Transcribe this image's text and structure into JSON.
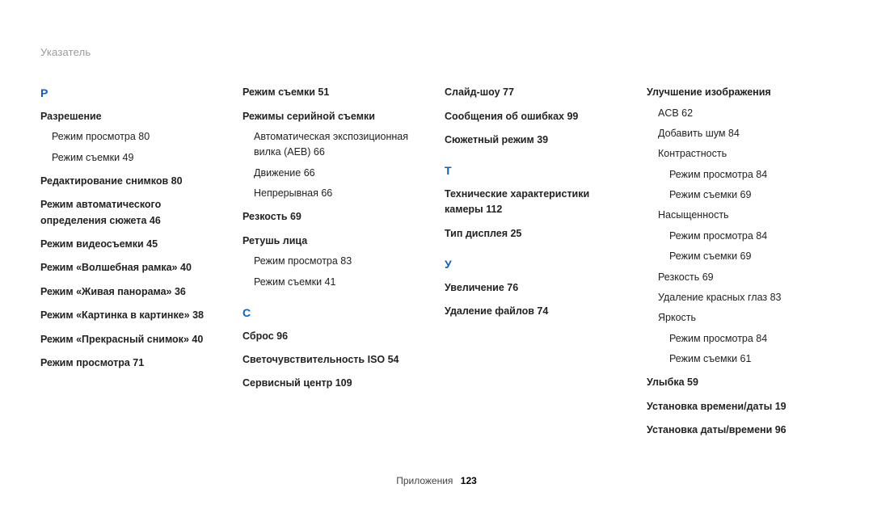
{
  "header": {
    "title": "Указатель"
  },
  "footer": {
    "section": "Приложения",
    "page": "123"
  },
  "col1": {
    "letter": "Р",
    "e1": {
      "t": "Разрешение"
    },
    "e1s1": "Режим просмотра  80",
    "e1s2": "Режим съемки  49",
    "e2": "Редактирование снимков  80",
    "e3a": "Режим автоматического",
    "e3b": "определения сюжета  46",
    "e4": "Режим видеосъемки  45",
    "e5": "Режим «Волшебная рамка»  40",
    "e6": "Режим «Живая панорама»  36",
    "e7": "Режим «Картинка в картинке»  38",
    "e8": "Режим «Прекрасный снимок»  40",
    "e9": "Режим просмотра  71"
  },
  "col2": {
    "e1": "Режим съемки  51",
    "e2": {
      "t": "Режимы серийной съемки"
    },
    "e2s1a": "Автоматическая экспозиционная",
    "e2s1b": "вилка (AEB)  66",
    "e2s2": "Движение  66",
    "e2s3": "Непрерывная  66",
    "e3": "Резкость  69",
    "e4": {
      "t": "Ретушь лица"
    },
    "e4s1": "Режим просмотра  83",
    "e4s2": "Режим съемки  41",
    "letter": "С",
    "e5": "Сброс  96",
    "e6": "Светочувствительность ISO  54",
    "e7": "Сервисный центр  109"
  },
  "col3": {
    "e1": "Слайд-шоу  77",
    "e2": "Сообщения об ошибках  99",
    "e3": "Сюжетный режим  39",
    "letterT": "Т",
    "e4a": "Технические характеристики",
    "e4b": "камеры  112",
    "e5": "Тип дисплея  25",
    "letterU": "У",
    "e6": "Увеличение  76",
    "e7": "Удаление файлов  74"
  },
  "col4": {
    "e1": {
      "t": "Улучшение изображения"
    },
    "e1s1": "ACB  62",
    "e1s2": "Добавить шум  84",
    "e1s3": "Контрастность",
    "e1s3a": "Режим просмотра  84",
    "e1s3b": "Режим съемки  69",
    "e1s4": "Насыщенность",
    "e1s4a": "Режим просмотра  84",
    "e1s4b": "Режим съемки  69",
    "e1s5": "Резкость  69",
    "e1s6": "Удаление красных глаз  83",
    "e1s7": "Яркость",
    "e1s7a": "Режим просмотра  84",
    "e1s7b": "Режим съемки  61",
    "e2": "Улыбка  59",
    "e3": "Установка времени/даты  19",
    "e4": "Установка даты/времени  96"
  }
}
